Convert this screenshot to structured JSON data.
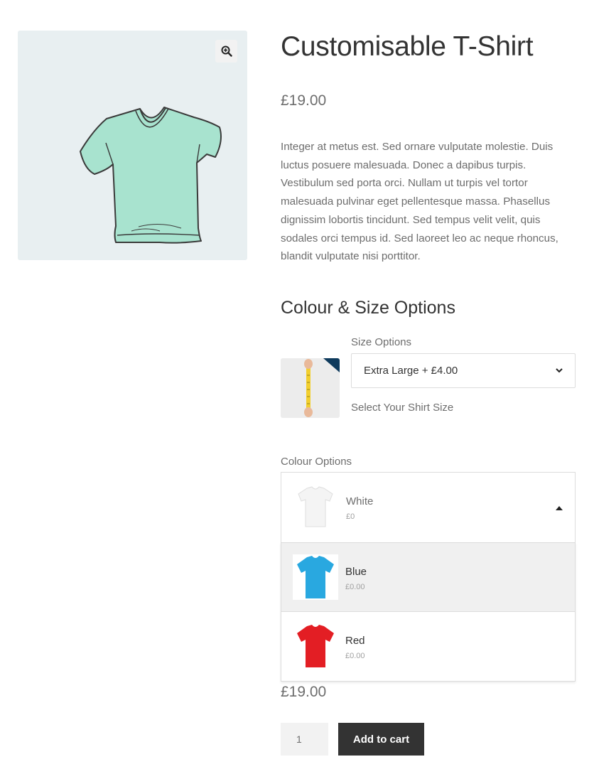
{
  "product": {
    "title": "Customisable T-Shirt",
    "price": "£19.00",
    "description": "Integer at metus est. Sed ornare vulputate molestie. Duis luctus posuere malesuada. Donec a dapibus turpis. Vestibulum sed porta orci. Nullam ut turpis vel tortor malesuada pulvinar eget pellentesque massa. Phasellus dignissim lobortis tincidunt. Sed tempus velit velit, quis sodales orci tempus id. Sed laoreet leo ac neque rhoncus, blandit vulputate nisi porttitor.",
    "image_icon": "tshirt-sketch",
    "zoom_icon": "zoom-in-icon"
  },
  "options": {
    "heading": "Colour & Size Options",
    "size": {
      "label": "Size Options",
      "selected": "Extra Large + £4.00",
      "help": "Select Your Shirt Size",
      "image_icon": "tape-measure"
    },
    "colour": {
      "label": "Colour Options",
      "selected": {
        "name": "White",
        "price": "£0",
        "color": "#f4f4f4"
      },
      "items": [
        {
          "name": "Blue",
          "price": "£0.00",
          "color": "#29a8e0"
        },
        {
          "name": "Red",
          "price": "£0.00",
          "color": "#e31e24"
        }
      ]
    }
  },
  "cart": {
    "total": "£19.00",
    "quantity": "1",
    "add_label": "Add to cart"
  },
  "colors": {
    "accent": "#333333",
    "shirt": "#a8e3cf"
  }
}
